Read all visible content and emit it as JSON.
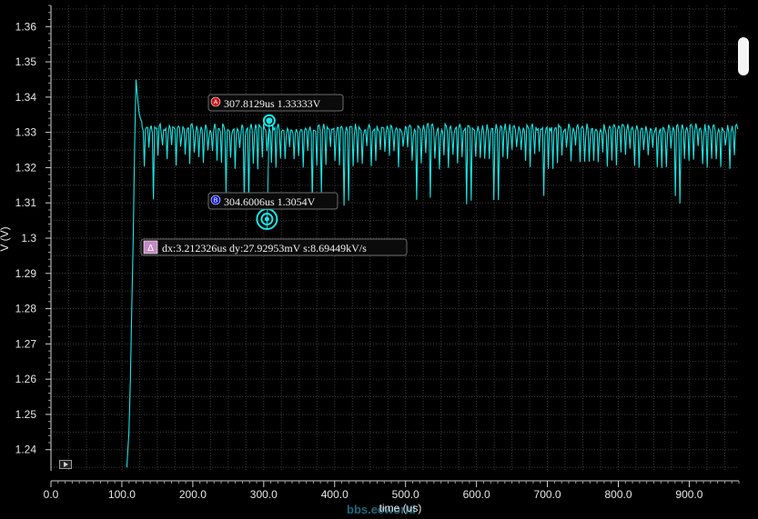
{
  "chart_data": {
    "type": "line",
    "title": "",
    "xlabel": "time (us)",
    "ylabel": "V (V)",
    "xlim": [
      0,
      970
    ],
    "ylim": [
      1.234,
      1.366
    ],
    "x_ticks": [
      0,
      100,
      200,
      300,
      400,
      500,
      600,
      700,
      800,
      900
    ],
    "x_tick_labels": [
      "0.0",
      "100.0",
      "200.0",
      "300.0",
      "400.0",
      "500.0",
      "600.0",
      "700.0",
      "800.0",
      "900.0"
    ],
    "y_ticks": [
      1.24,
      1.25,
      1.26,
      1.27,
      1.28,
      1.29,
      1.3,
      1.31,
      1.32,
      1.33,
      1.34,
      1.35,
      1.36
    ],
    "y_tick_labels": [
      "1.24",
      "1.25",
      "1.26",
      "1.27",
      "1.28",
      "1.29",
      "1.3",
      "1.31",
      "1.32",
      "1.33",
      "1.34",
      "1.35",
      "1.36"
    ],
    "grid": true,
    "series": [
      {
        "color": "#19e6e6",
        "x": [
          107,
          110,
          112,
          114,
          116,
          118,
          120,
          122,
          124,
          126,
          128,
          130,
          135,
          140,
          150,
          160,
          170,
          180,
          190,
          200,
          220,
          240,
          260,
          280,
          300,
          320,
          340,
          360,
          380,
          400,
          450,
          500,
          550,
          600,
          650,
          700,
          750,
          800,
          850,
          900,
          950,
          970
        ],
        "y": [
          1.235,
          1.245,
          1.26,
          1.28,
          1.3,
          1.327,
          1.345,
          1.34,
          1.336,
          1.334,
          1.333,
          1.332,
          1.331,
          1.332,
          1.331,
          1.332,
          1.331,
          1.331,
          1.332,
          1.331,
          1.332,
          1.331,
          1.331,
          1.332,
          1.331,
          1.331,
          1.332,
          1.331,
          1.331,
          1.332,
          1.331,
          1.331,
          1.332,
          1.331,
          1.331,
          1.332,
          1.331,
          1.331,
          1.332,
          1.331,
          1.331,
          1.332
        ],
        "ripple": {
          "period_us": 6.4,
          "high": 1.3325,
          "low": 1.3195,
          "spike_low": 1.309
        }
      }
    ],
    "markers": [
      {
        "id": "A",
        "x": 307.8129,
        "y": 1.33333,
        "label": "307.8129us 1.33333V",
        "color": "#cc1111"
      },
      {
        "id": "B",
        "x": 304.6006,
        "y": 1.3054,
        "label": "304.6006us 1.3054V",
        "color": "#1a1acc"
      }
    ],
    "delta": {
      "symbol": "Δ",
      "label": "dx:3.212326us dy:27.92953mV s:8.69449kV/s"
    }
  },
  "watermark": "bbs.eeworld",
  "icons": {
    "play": "play-icon",
    "scroll": "scrollbar-thumb"
  }
}
